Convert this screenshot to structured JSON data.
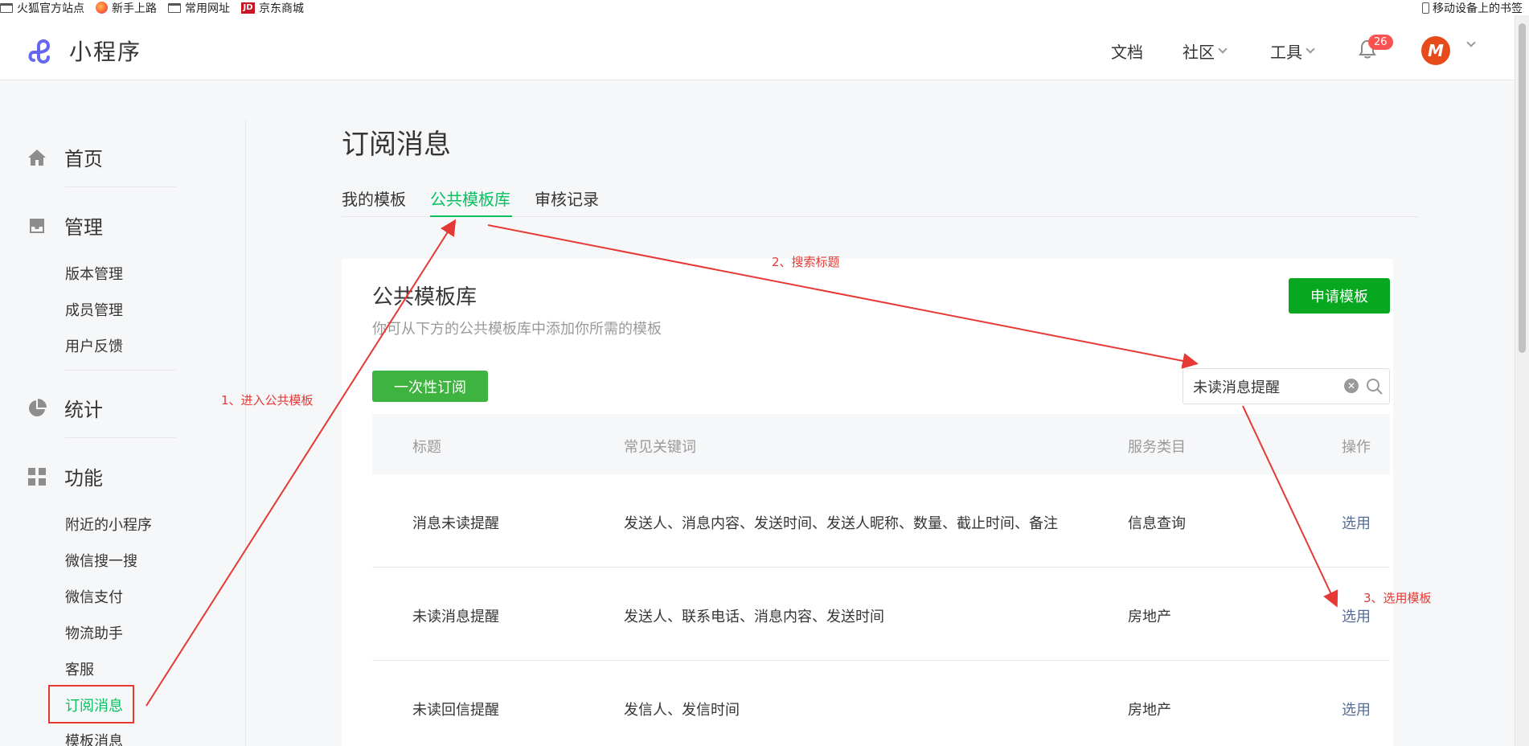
{
  "bookmarks": {
    "items": [
      {
        "label": "火狐官方站点",
        "icon": "folder-icon"
      },
      {
        "label": "新手上路",
        "icon": "firefox-icon"
      },
      {
        "label": "常用网址",
        "icon": "folder-icon"
      },
      {
        "label": "京东商城",
        "icon": "jd-icon",
        "icon_text": "JD"
      }
    ],
    "mobile_label": "移动设备上的书签"
  },
  "header": {
    "app_name": "小程序",
    "nav": {
      "docs": "文档",
      "community": "社区",
      "tools": "工具"
    },
    "notification_count": "26",
    "avatar_letter": "M"
  },
  "sidebar": {
    "home": "首页",
    "manage": "管理",
    "manage_items": [
      "版本管理",
      "成员管理",
      "用户反馈"
    ],
    "stats": "统计",
    "features": "功能",
    "feature_items": [
      "附近的小程序",
      "微信搜一搜",
      "微信支付",
      "物流助手",
      "客服",
      "订阅消息",
      "模板消息"
    ]
  },
  "main": {
    "title": "订阅消息",
    "tabs": [
      "我的模板",
      "公共模板库",
      "审核记录"
    ],
    "active_tab": "公共模板库",
    "card": {
      "title": "公共模板库",
      "description": "你可从下方的公共模板库中添加你所需的模板",
      "apply_button": "申请模板",
      "once_button": "一次性订阅",
      "search_value": "未读消息提醒"
    },
    "table": {
      "headers": [
        "标题",
        "常见关键词",
        "服务类目",
        "操作"
      ],
      "rows": [
        {
          "title": "消息未读提醒",
          "keywords": "发送人、消息内容、发送时间、发送人昵称、数量、截止时间、备注",
          "category": "信息查询",
          "action": "选用"
        },
        {
          "title": "未读消息提醒",
          "keywords": "发送人、联系电话、消息内容、发送时间",
          "category": "房地产",
          "action": "选用"
        },
        {
          "title": "未读回信提醒",
          "keywords": "发信人、发信时间",
          "category": "房地产",
          "action": "选用"
        }
      ]
    }
  },
  "annotations": {
    "step1": "1、进入公共模板",
    "step2": "2、搜索标题",
    "step3": "3、选用模板",
    "color": "#e53935"
  }
}
